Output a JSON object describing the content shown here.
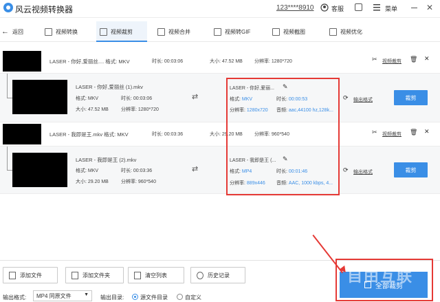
{
  "titlebar": {
    "app_title": "风云视频转换器",
    "account": "123****8910",
    "service": "客服",
    "menu": "菜单"
  },
  "nav": {
    "back": "返回",
    "items": [
      "视频转换",
      "视频裁剪",
      "视频合并",
      "视频转GIF",
      "视频截图",
      "视频优化"
    ],
    "active_index": 1
  },
  "files": [
    {
      "title": "LASER - 你好,爱丽丝.... 格式: MKV",
      "duration": "时长: 00:03:06",
      "size": "大小: 47.52 MB",
      "resolution": "分辨率: 1280*720",
      "action_crop": "视频裁剪",
      "sub": {
        "name": "LASER - 你好,爱丽丝 (1).mkv",
        "format": "格式: MKV",
        "duration": "时长: 00:03:06",
        "size": "大小: 47.52 MB",
        "resolution": "分辨率: 1280*720",
        "out_name": "LASER - 你好,爱丽...",
        "out_format_label": "格式:",
        "out_format": "MKV",
        "out_duration_label": "时长:",
        "out_duration": "00:00:53",
        "out_res_label": "分辨率:",
        "out_res": "1280x720",
        "out_audio_label": "音频:",
        "out_audio": "aac,44100 hz,128k...",
        "output_format": "输出格式",
        "crop_button": "裁剪"
      }
    },
    {
      "title": "LASER - 我即是王.mkv 格式: MKV",
      "duration": "时长: 00:03:36",
      "size": "大小: 29.20 MB",
      "resolution": "分辨率: 960*540",
      "action_crop": "视频裁剪",
      "sub": {
        "name": "LASER - 我即是王 (2).mkv",
        "format": "格式: MKV",
        "duration": "时长: 00:03:36",
        "size": "大小: 29.20 MB",
        "resolution": "分辨率: 960*540",
        "out_name": "LASER - 我即是王 (...",
        "out_format_label": "格式:",
        "out_format": "MP4",
        "out_duration_label": "时长:",
        "out_duration": "00:01:46",
        "out_res_label": "分辨率:",
        "out_res": "889x446",
        "out_audio_label": "音频:",
        "out_audio": "AAC, 1000 kbps, 4...",
        "output_format": "输出格式",
        "crop_button": "裁剪"
      }
    }
  ],
  "bottom": {
    "add_file": "添加文件",
    "add_folder": "添加文件夹",
    "clear_list": "清空列表",
    "history": "历史记录",
    "output_format_label": "输出格式:",
    "output_format_value": "MP4 同原文件",
    "output_dir_label": "输出目录:",
    "radio_source": "源文件目录",
    "radio_custom": "自定义",
    "crop_all": "全部裁剪",
    "watermark": "自由互联"
  },
  "colors": {
    "accent": "#3a8ee6",
    "highlight": "#e53935"
  }
}
